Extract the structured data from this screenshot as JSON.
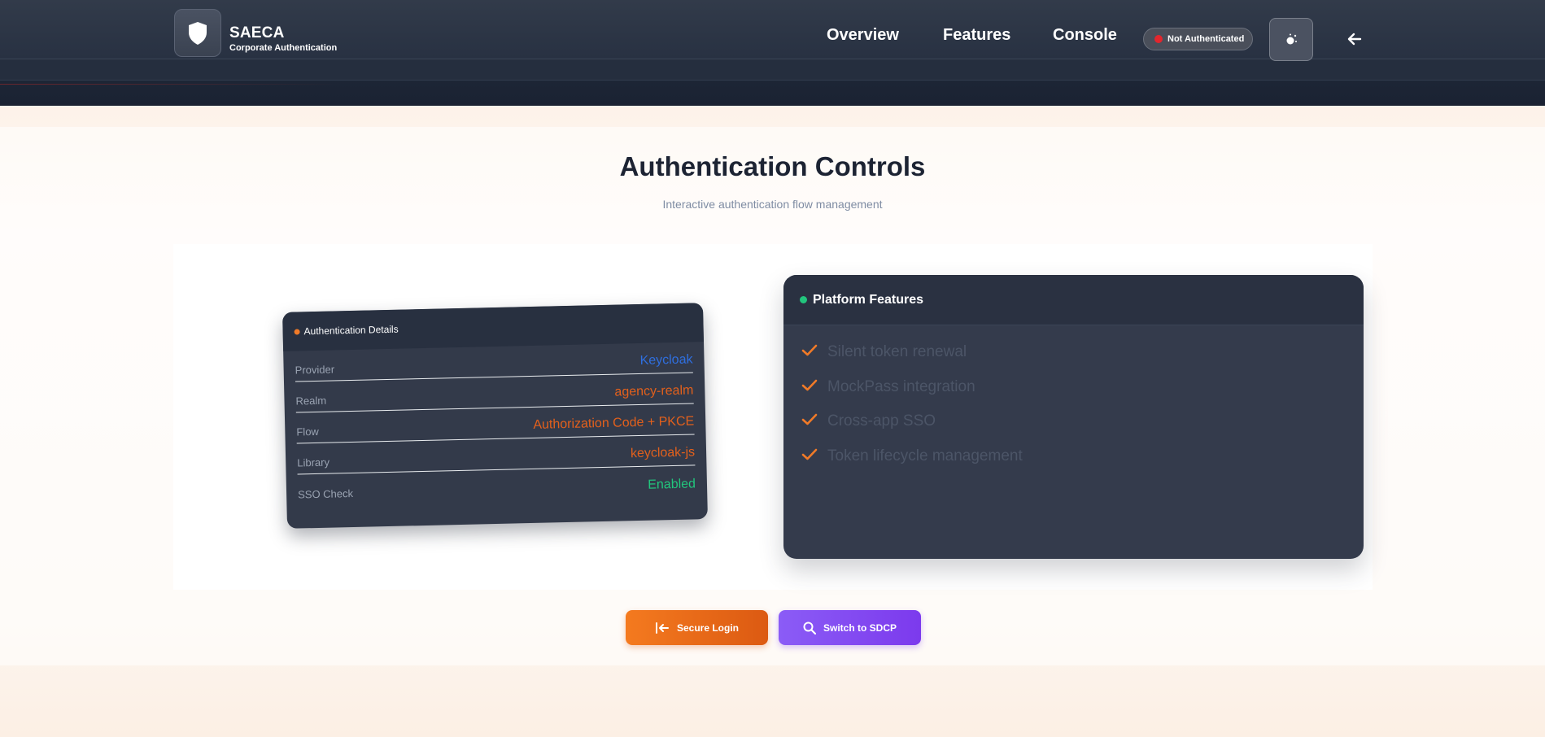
{
  "brand": {
    "title": "SAECA",
    "subtitle": "Corporate Authentication",
    "logo_icon": "shield-icon"
  },
  "nav": [
    {
      "label": "Overview"
    },
    {
      "label": "Features"
    },
    {
      "label": "Console"
    }
  ],
  "status": {
    "label": "Not Authenticated",
    "color": "#e3262d"
  },
  "header_actions": {
    "theme_icon": "sun-icon",
    "back_icon": "arrow-left-icon"
  },
  "page": {
    "title": "Authentication Controls",
    "subtitle": "Interactive authentication flow management"
  },
  "details": {
    "title": "Authentication Details",
    "rows": [
      {
        "label": "Provider",
        "value": "Keycloak",
        "color": "#2f6fe0"
      },
      {
        "label": "Realm",
        "value": "agency-realm",
        "color": "#e2601c"
      },
      {
        "label": "Flow",
        "value": "Authorization Code + PKCE",
        "color": "#e2601c"
      },
      {
        "label": "Library",
        "value": "keycloak-js",
        "color": "#e2601c"
      },
      {
        "label": "SSO Check",
        "value": "Enabled",
        "color": "#22c57d"
      }
    ]
  },
  "features": {
    "title": "Platform Features",
    "items": [
      {
        "label": "Silent token renewal"
      },
      {
        "label": "MockPass integration"
      },
      {
        "label": "Cross-app SSO"
      },
      {
        "label": "Token lifecycle management"
      }
    ]
  },
  "actions": {
    "login_label": "Secure Login",
    "login_icon": "login-arrow-icon",
    "switch_label": "Switch to SDCP",
    "switch_icon": "search-icon"
  },
  "colors": {
    "accent_orange": "#f47a1f",
    "accent_purple": "#8b5cf6",
    "header_dark": "#283142"
  }
}
